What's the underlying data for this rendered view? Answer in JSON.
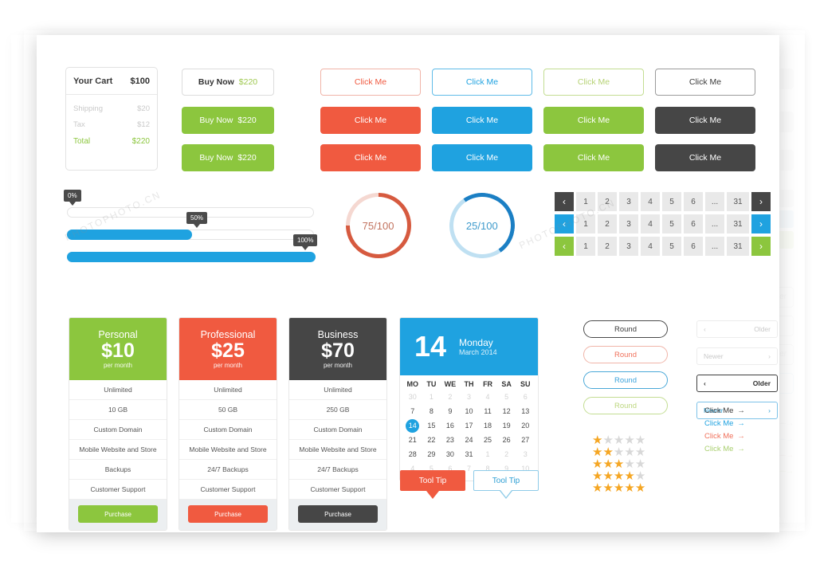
{
  "colors": {
    "red": "#f05a40",
    "blue": "#1fa2e0",
    "green": "#8cc63e",
    "dark": "#464646",
    "grey_track": "#e9e9e9",
    "star_on": "#f5a623",
    "star_off": "#d8d8d8"
  },
  "cart": {
    "title": "Your Cart",
    "total_header": "$100",
    "rows": [
      {
        "label": "Shipping",
        "value": "$20"
      },
      {
        "label": "Tax",
        "value": "$12"
      }
    ],
    "total_label": "Total",
    "total_value": "$220"
  },
  "buy_buttons": [
    {
      "label": "Buy Now",
      "price": "$220",
      "style": "outline"
    },
    {
      "label": "Buy Now",
      "price": "$220",
      "style": "solid"
    },
    {
      "label": "Buy Now",
      "price": "$220",
      "style": "solid"
    }
  ],
  "click_me": {
    "label": "Click Me",
    "columns": [
      "red",
      "blue",
      "green",
      "dark"
    ]
  },
  "sliders": [
    {
      "percent_label": "0%",
      "value": 0
    },
    {
      "percent_label": "50%",
      "value": 50
    },
    {
      "percent_label": "100%",
      "value": 100
    }
  ],
  "donuts": [
    {
      "label": "75/100",
      "value": 75,
      "color": "red"
    },
    {
      "label": "25/100",
      "value": 25,
      "color": "blue"
    }
  ],
  "pagination": {
    "prev_icon": "chevron-left",
    "next_icon": "chevron-right",
    "pages": [
      "1",
      "2",
      "3",
      "4",
      "5",
      "6",
      "...",
      "31"
    ],
    "rows": [
      "dark",
      "blue",
      "green"
    ]
  },
  "plans": [
    {
      "name": "Personal",
      "price": "$10",
      "period": "per month",
      "color": "green",
      "features": [
        "Unlimited",
        "10 GB",
        "Custom Domain",
        "Mobile Website and Store",
        "Backups",
        "Customer Support"
      ],
      "cta": "Purchase"
    },
    {
      "name": "Professional",
      "price": "$25",
      "period": "per month",
      "color": "red",
      "features": [
        "Unlimited",
        "50 GB",
        "Custom Domain",
        "Mobile Website and Store",
        "24/7 Backups",
        "Customer Support"
      ],
      "cta": "Purchase"
    },
    {
      "name": "Business",
      "price": "$70",
      "period": "per month",
      "color": "dark",
      "features": [
        "Unlimited",
        "250 GB",
        "Custom Domain",
        "Mobile Website and Store",
        "24/7 Backups",
        "Customer Support"
      ],
      "cta": "Purchase"
    }
  ],
  "calendar": {
    "day_number": "14",
    "weekday": "Monday",
    "month_year": "March 2014",
    "dow": [
      "MO",
      "TU",
      "WE",
      "TH",
      "FR",
      "SA",
      "SU"
    ],
    "weeks": [
      [
        {
          "d": "30",
          "m": true
        },
        {
          "d": "1",
          "m": true
        },
        {
          "d": "2",
          "m": true
        },
        {
          "d": "3",
          "m": true
        },
        {
          "d": "4",
          "m": true
        },
        {
          "d": "5",
          "m": true
        },
        {
          "d": "6",
          "m": true
        }
      ],
      [
        {
          "d": "7"
        },
        {
          "d": "8"
        },
        {
          "d": "9"
        },
        {
          "d": "10"
        },
        {
          "d": "11"
        },
        {
          "d": "12"
        },
        {
          "d": "13"
        }
      ],
      [
        {
          "d": "14",
          "sel": true
        },
        {
          "d": "15"
        },
        {
          "d": "16"
        },
        {
          "d": "17"
        },
        {
          "d": "18"
        },
        {
          "d": "19"
        },
        {
          "d": "20"
        }
      ],
      [
        {
          "d": "21"
        },
        {
          "d": "22"
        },
        {
          "d": "23"
        },
        {
          "d": "24"
        },
        {
          "d": "25"
        },
        {
          "d": "26"
        },
        {
          "d": "27"
        }
      ],
      [
        {
          "d": "28"
        },
        {
          "d": "29"
        },
        {
          "d": "30"
        },
        {
          "d": "31"
        },
        {
          "d": "1",
          "m": true
        },
        {
          "d": "2",
          "m": true
        },
        {
          "d": "3",
          "m": true
        }
      ],
      [
        {
          "d": "4",
          "m": true
        },
        {
          "d": "5",
          "m": true
        },
        {
          "d": "6",
          "m": true
        },
        {
          "d": "7",
          "m": true
        },
        {
          "d": "8",
          "m": true
        },
        {
          "d": "9",
          "m": true
        },
        {
          "d": "10",
          "m": true
        }
      ]
    ]
  },
  "round_buttons": [
    {
      "label": "Round",
      "color": "dark"
    },
    {
      "label": "Round",
      "color": "red"
    },
    {
      "label": "Round",
      "color": "blue"
    },
    {
      "label": "Round",
      "color": "green"
    }
  ],
  "nav_buttons": [
    {
      "label": "Older",
      "dir": "prev",
      "state": "muted",
      "arrow": "‹"
    },
    {
      "label": "Newer",
      "dir": "next",
      "state": "muted",
      "arrow": "›"
    },
    {
      "label": "Older",
      "dir": "prev",
      "state": "dark",
      "arrow": "‹"
    },
    {
      "label": "Newer",
      "dir": "next",
      "state": "blue",
      "arrow": "›"
    }
  ],
  "star_rows": [
    1,
    2,
    3,
    4,
    5
  ],
  "star_total": 5,
  "star_glyph": "★",
  "arrow_links": [
    {
      "label": "Click Me",
      "arrow": "→",
      "color": "dark"
    },
    {
      "label": "Click Me",
      "arrow": "→",
      "color": "blue"
    },
    {
      "label": "Click Me",
      "arrow": "→",
      "color": "red"
    },
    {
      "label": "Click Me",
      "arrow": "→",
      "color": "green"
    }
  ],
  "tooltips": [
    {
      "label": "Tool Tip",
      "style": "solid"
    },
    {
      "label": "Tool Tip",
      "style": "outline"
    }
  ],
  "ghost": {
    "click_me": "Me",
    "page": "31",
    "older": "Older",
    "newer": "Newer"
  },
  "watermark": {
    "text": "PHOTOPHOTO.CN"
  }
}
